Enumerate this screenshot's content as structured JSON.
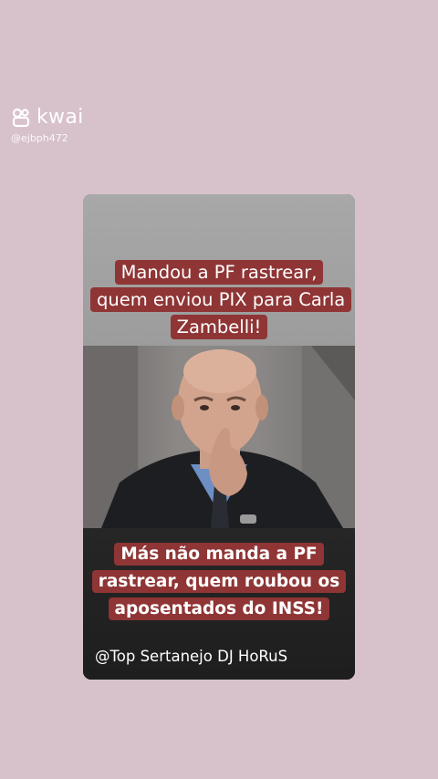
{
  "watermark": {
    "brand": "kwai",
    "handle": "@ejbph472"
  },
  "card": {
    "headline_top": "Mandou a PF rastrear, quem enviou PIX  para Carla Zambelli!",
    "headline_bottom": "Más não manda a PF rastrear, quem roubou os aposentados do INSS!",
    "credit": "@Top Sertanejo DJ HoRuS"
  },
  "colors": {
    "background": "#d7c1cb",
    "caption_box": "#8f3535",
    "caption_text": "#ffffff"
  }
}
